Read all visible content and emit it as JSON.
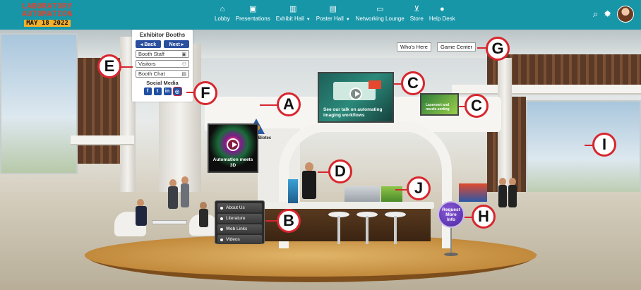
{
  "brand": {
    "line1": "LABORATORY",
    "line2": "AUTOMATION",
    "date": "MAY 18 2022"
  },
  "nav": [
    {
      "icon": "home-icon",
      "glyph": "⌂",
      "label": "Lobby"
    },
    {
      "icon": "presentation-icon",
      "glyph": "▣",
      "label": "Presentations"
    },
    {
      "icon": "building-icon",
      "glyph": "▥",
      "label": "Exhibit Hall",
      "caret": "▼"
    },
    {
      "icon": "poster-icon",
      "glyph": "▤",
      "label": "Poster Hall",
      "caret": "▼"
    },
    {
      "icon": "chat-icon",
      "glyph": "▭",
      "label": "Networking Lounge"
    },
    {
      "icon": "cart-icon",
      "glyph": "⊻",
      "label": "Store"
    },
    {
      "icon": "help-icon",
      "glyph": "●",
      "label": "Help Desk"
    }
  ],
  "topright": {
    "search": "⌕",
    "settings": "✹"
  },
  "exhibitor": {
    "title": "Exhibitor Booths",
    "back": "◂ Back",
    "next": "Next ▸",
    "fields": [
      {
        "label": "Booth Staff",
        "icon": "▣"
      },
      {
        "label": "Visitors",
        "icon": "⚇"
      },
      {
        "label": "Booth Chat",
        "icon": "▤"
      }
    ],
    "social_title": "Social Media",
    "social": [
      {
        "name": "facebook-icon",
        "glyph": "f"
      },
      {
        "name": "twitter-icon",
        "glyph": "t"
      },
      {
        "name": "linkedin-icon",
        "glyph": "in"
      },
      {
        "name": "instagram-icon",
        "glyph": "◎"
      }
    ]
  },
  "chips": {
    "whos_here": "Who's Here",
    "game_center": "Game Center"
  },
  "booth": {
    "company": "Miltenyi Biotec"
  },
  "screens": {
    "main": "See our talk on automating imaging workflows",
    "small": "Lasersort and nozzle sorting",
    "left": "Automation meets 3D"
  },
  "menu": [
    "About Us",
    "Literature",
    "Web Links",
    "Videos"
  ],
  "request": {
    "l1": "Request",
    "l2": "More",
    "l3": "Info"
  },
  "callouts": {
    "A": "A",
    "B": "B",
    "C1": "C",
    "C2": "C",
    "D": "D",
    "E": "E",
    "F": "F",
    "G": "G",
    "H": "H",
    "I": "I",
    "J": "J"
  },
  "colors": {
    "topbar": "#1796a8",
    "callout": "#d8262e",
    "exhibitor_button": "#2a4f9f",
    "request": "#5a2db0"
  }
}
